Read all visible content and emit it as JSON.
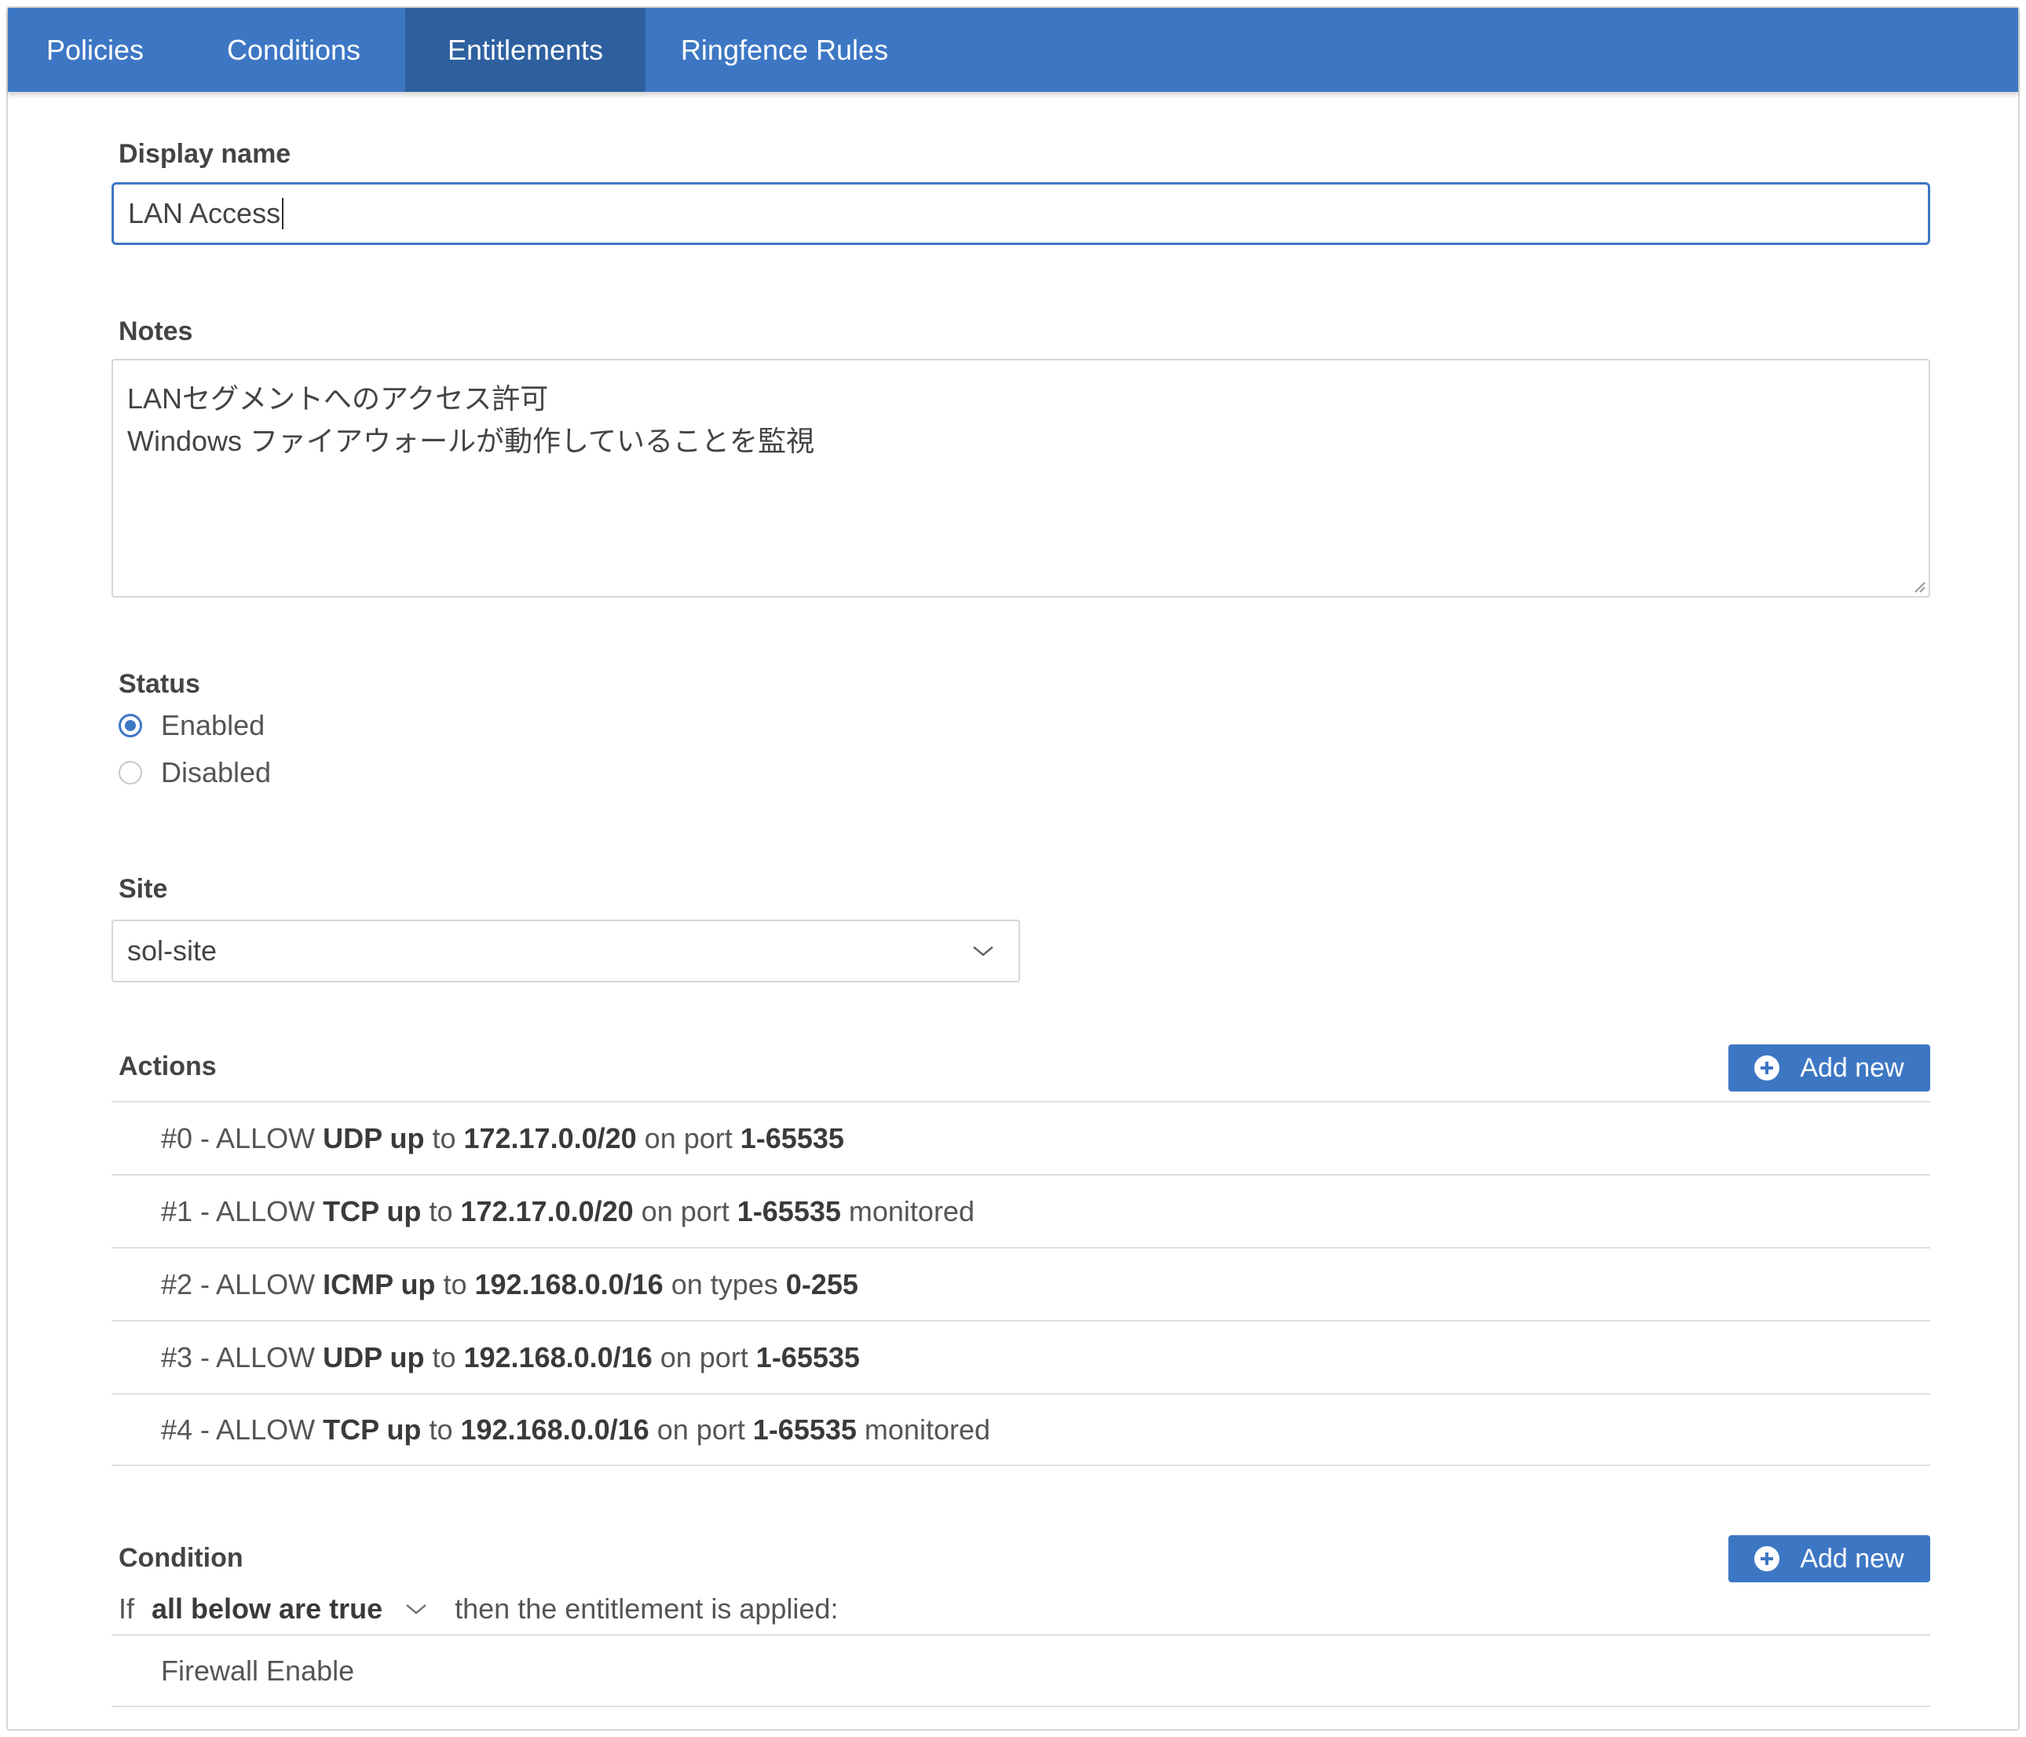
{
  "tabs": [
    {
      "label": "Policies",
      "active": false
    },
    {
      "label": "Conditions",
      "active": false
    },
    {
      "label": "Entitlements",
      "active": true
    },
    {
      "label": "Ringfence Rules",
      "active": false
    }
  ],
  "colors": {
    "accent": "#3d77c4",
    "active_tab": "#2e60a0",
    "border": "#d6d6d6"
  },
  "display_name": {
    "label": "Display name",
    "value": "LAN Access"
  },
  "notes": {
    "label": "Notes",
    "lines": [
      "LANセグメントへのアクセス許可",
      "Windows ファイアウォールが動作していることを監視"
    ]
  },
  "status": {
    "label": "Status",
    "options": [
      {
        "label": "Enabled",
        "checked": true
      },
      {
        "label": "Disabled",
        "checked": false
      }
    ]
  },
  "site": {
    "label": "Site",
    "value": "sol-site",
    "icon": "chevron-down-icon"
  },
  "actions": {
    "label": "Actions",
    "add_label": "Add new",
    "items": [
      {
        "prefix": "#0 - ALLOW ",
        "proto": "UDP up",
        "to": " to ",
        "target": "172.17.0.0/20",
        "on": " on port ",
        "range": "1-65535",
        "suffix": ""
      },
      {
        "prefix": "#1 - ALLOW ",
        "proto": "TCP up",
        "to": " to ",
        "target": "172.17.0.0/20",
        "on": " on port ",
        "range": "1-65535",
        "suffix": " monitored"
      },
      {
        "prefix": "#2 - ALLOW ",
        "proto": "ICMP up",
        "to": " to ",
        "target": "192.168.0.0/16",
        "on": " on types ",
        "range": "0-255",
        "suffix": ""
      },
      {
        "prefix": "#3 - ALLOW ",
        "proto": "UDP up",
        "to": " to ",
        "target": "192.168.0.0/16",
        "on": " on port ",
        "range": "1-65535",
        "suffix": ""
      },
      {
        "prefix": "#4 - ALLOW ",
        "proto": "TCP up",
        "to": " to ",
        "target": "192.168.0.0/16",
        "on": " on port ",
        "range": "1-65535",
        "suffix": " monitored"
      }
    ]
  },
  "condition": {
    "label": "Condition",
    "add_label": "Add new",
    "if_text": "If",
    "mode": "all below are true",
    "then_text": "then the entitlement is applied:",
    "items": [
      "Firewall Enable"
    ]
  }
}
